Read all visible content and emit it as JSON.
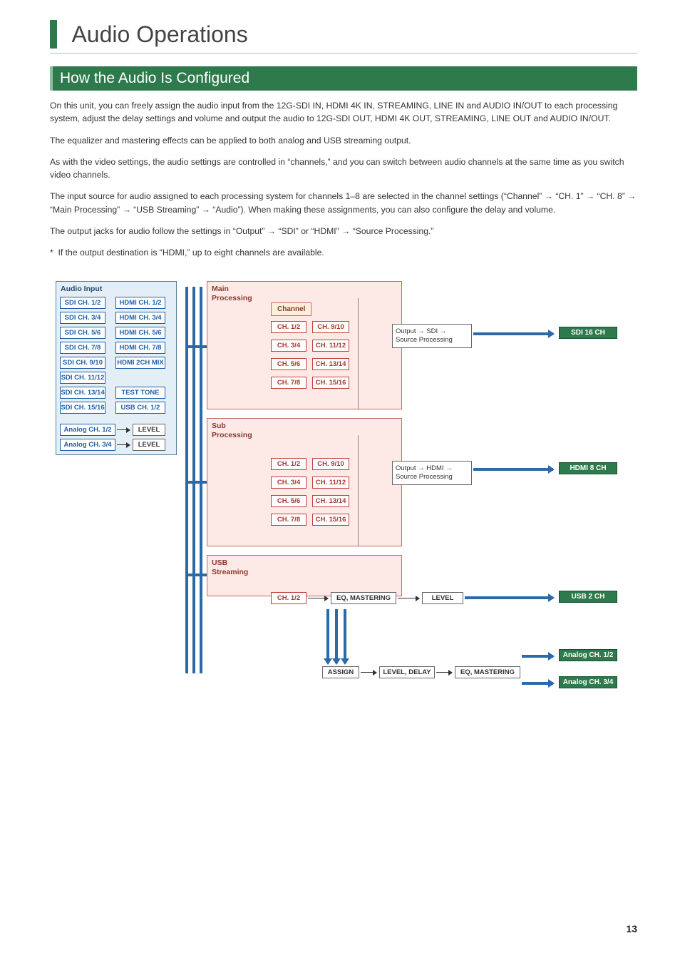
{
  "page_number": "13",
  "title": "Audio Operations",
  "section_title": "How the Audio Is Configured",
  "paragraphs": {
    "p1": "On this unit, you can freely assign the audio input from the 12G-SDI IN, HDMI 4K IN, STREAMING, LINE IN and AUDIO IN/OUT to each processing system, adjust the delay settings and volume and output the audio to 12G-SDI OUT, HDMI 4K OUT, STREAMING, LINE OUT and AUDIO IN/OUT.",
    "p2": "The equalizer and mastering effects can be applied to both analog and USB streaming output.",
    "p3": "As with the video settings, the audio settings are controlled in “channels,” and you can switch between audio channels at the same time as you switch video channels.",
    "p4a": "The input source for audio assigned to each processing system for channels 1–8 are selected in the channel settings (“Channel” ",
    "p4b": " “CH. 1” ",
    "p4c": " “CH. 8” ",
    "p4d": " “Main Processing” ",
    "p4e": " “USB Streaming” ",
    "p4f": " “Audio”). When making these assignments, you can also configure the delay and volume.",
    "p5a": "The output jacks for audio follow the settings in “Output” ",
    "p5b": " “SDI” or “HDMI” ",
    "p5c": " “Source Processing.”",
    "note": "*  If the output destination is “HDMI,” up to eight channels are available."
  },
  "diagram": {
    "audio_input_hdr": "Audio Input",
    "main_hdr": "Main Processing",
    "sub_hdr": "Sub Processing",
    "usb_hdr": "USB Streaming",
    "channel_label": "Channel",
    "sdi_inputs": [
      "SDI CH. 1/2",
      "SDI CH. 3/4",
      "SDI CH. 5/6",
      "SDI CH. 7/8",
      "SDI CH. 9/10",
      "SDI CH. 11/12",
      "SDI CH. 13/14",
      "SDI CH. 15/16"
    ],
    "hdmi_inputs": [
      "HDMI CH. 1/2",
      "HDMI CH. 3/4",
      "HDMI CH. 5/6",
      "HDMI CH. 7/8",
      "HDMI 2CH MIX"
    ],
    "test_tone": "TEST TONE",
    "usb_input": "USB CH. 1/2",
    "analog_inputs": [
      "Analog CH. 1/2",
      "Analog CH. 3/4"
    ],
    "level_label": "LEVEL",
    "main_channels_l": [
      "CH. 1/2",
      "CH. 3/4",
      "CH. 5/6",
      "CH. 7/8"
    ],
    "main_channels_r": [
      "CH. 9/10",
      "CH. 11/12",
      "CH. 13/14",
      "CH. 15/16"
    ],
    "output_sdi": "Output → SDI → Source Processing",
    "output_hdmi": "Output → HDMI → Source Processing",
    "ch12": "CH. 1/2",
    "eq_mastering": "EQ, MASTERING",
    "level": "LEVEL",
    "assign": "ASSIGN",
    "level_delay": "LEVEL, DELAY",
    "outputs": {
      "sdi": "SDI 16 CH",
      "hdmi": "HDMI 8 CH",
      "usb": "USB 2 CH",
      "analog1": "Analog CH. 1/2",
      "analog2": "Analog CH. 3/4"
    }
  }
}
